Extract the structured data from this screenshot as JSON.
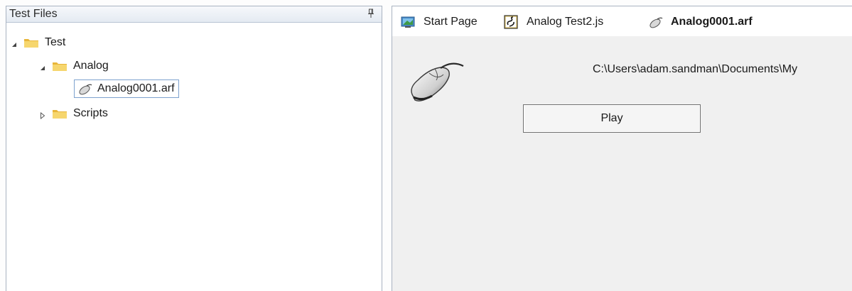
{
  "left_panel": {
    "title": "Test Files",
    "tree": {
      "root": {
        "label": "Test",
        "expanded": true
      },
      "analog": {
        "label": "Analog",
        "expanded": true
      },
      "file": {
        "label": "Analog0001.arf",
        "selected": true
      },
      "scripts": {
        "label": "Scripts",
        "expanded": false
      }
    }
  },
  "tabs": [
    {
      "label": "Start Page",
      "icon": "start-page-icon",
      "active": false
    },
    {
      "label": "Analog Test2.js",
      "icon": "script-file-icon",
      "active": false
    },
    {
      "label": "Analog0001.arf",
      "icon": "mouse-file-icon",
      "active": true
    }
  ],
  "document": {
    "path": "C:\\Users\\adam.sandman\\Documents\\My",
    "play_label": "Play",
    "image_icon": "mouse-icon"
  },
  "colors": {
    "folder": "#f2c94c",
    "selection_border": "#7da2ce",
    "panel_border": "#a9b3c1",
    "content_bg": "#f0f0f0"
  }
}
